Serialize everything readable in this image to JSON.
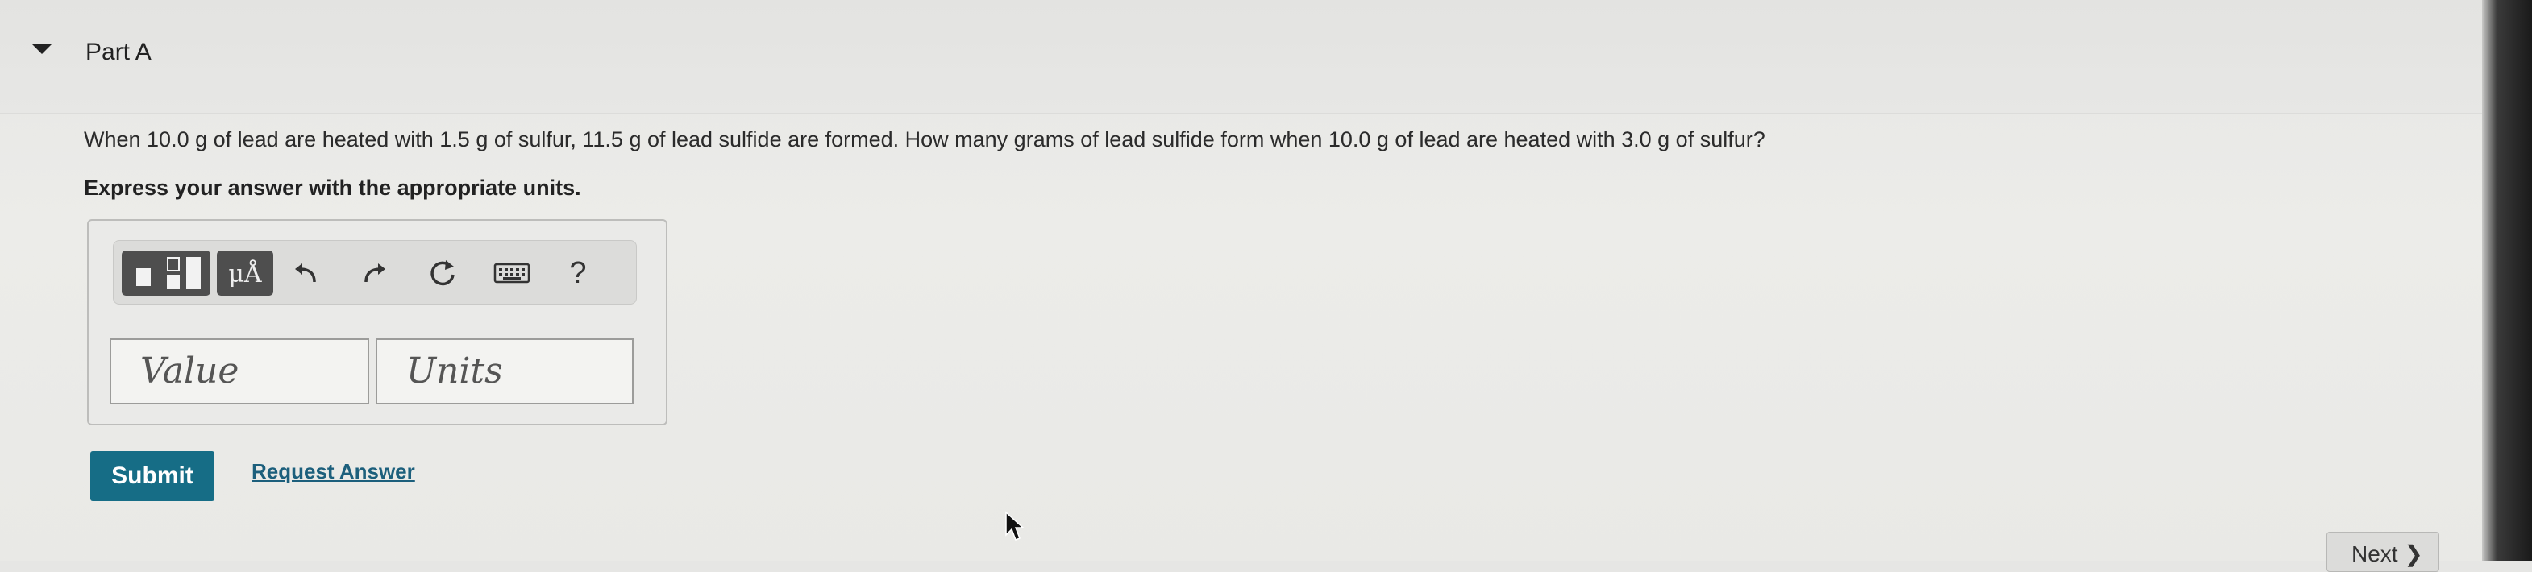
{
  "part": {
    "title": "Part A",
    "toggle_icon": "caret-down-icon"
  },
  "question": {
    "text": "When 10.0 g of lead are heated with 1.5 g of sulfur, 11.5 g of lead sulfide are formed. How many grams of lead sulfide form when 10.0 g of lead are heated with 3.0 g of sulfur?",
    "instruction": "Express your answer with the appropriate units."
  },
  "toolbar": {
    "templates_icon": "templates-icon",
    "units_label": "μÅ",
    "undo_icon": "undo-icon",
    "redo_icon": "redo-icon",
    "reset_icon": "reset-icon",
    "keyboard_icon": "keyboard-icon",
    "help_label": "?"
  },
  "answer": {
    "value_placeholder": "Value",
    "units_placeholder": "Units"
  },
  "actions": {
    "submit_label": "Submit",
    "request_answer_label": "Request Answer",
    "next_label": "Next ❯"
  },
  "colors": {
    "submit_bg": "#166d86",
    "link": "#1c5f7c",
    "toolbar_dark": "#4e4e4e"
  }
}
